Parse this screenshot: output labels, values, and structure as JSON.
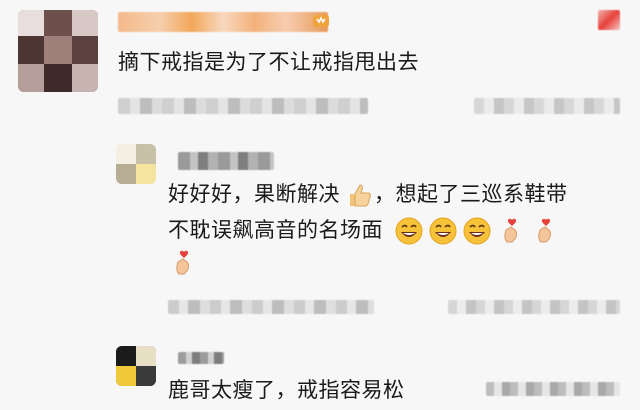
{
  "comment": {
    "text": "摘下戒指是为了不让戒指甩出去"
  },
  "reply1": {
    "line1": "好好好，果断解决",
    "line1b": "，想起了三巡系鞋带",
    "line2": "不耽误飙高音的名场面",
    "emoji": {
      "thumbs_up": "thumbs-up-emoji",
      "laugh": "grinning-tears-emoji",
      "finger_heart": "finger-heart-emoji"
    }
  },
  "reply2": {
    "text": "鹿哥太瘦了，戒指容易松"
  },
  "colors": {
    "background": "#f7f7f7",
    "text": "#1a1a1a",
    "blur_gray": "#c8c8c8",
    "blur_orange": "#f2a75a",
    "accent_red": "#e8413a"
  }
}
